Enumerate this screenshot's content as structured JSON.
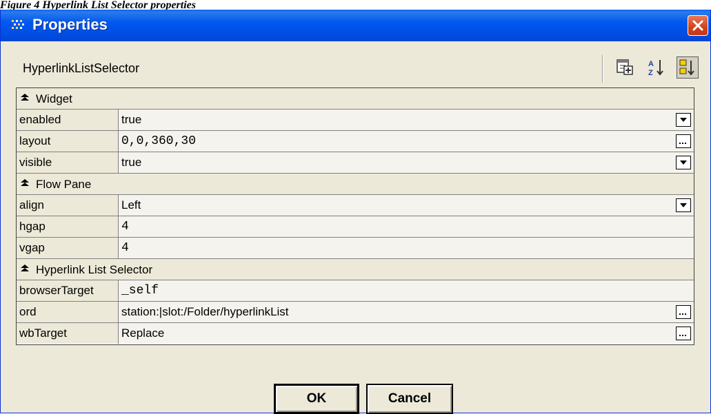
{
  "caption": "Figure 4 Hyperlink List Selector properties",
  "window": {
    "title": "Properties",
    "header": "HyperlinkListSelector",
    "icons": [
      "properties-app-icon",
      "add-slot-icon",
      "sort-alpha-icon",
      "sort-natural-icon",
      "close-icon"
    ]
  },
  "categories": [
    {
      "label": "Widget",
      "props": [
        {
          "name": "enabled",
          "value": "true",
          "control": "dropdown"
        },
        {
          "name": "layout",
          "value": "0,0,360,30",
          "control": "ellipsis"
        },
        {
          "name": "visible",
          "value": "true",
          "control": "dropdown"
        }
      ]
    },
    {
      "label": "Flow Pane",
      "props": [
        {
          "name": "align",
          "value": "Left",
          "control": "dropdown"
        },
        {
          "name": "hgap",
          "value": "4"
        },
        {
          "name": "vgap",
          "value": "4"
        }
      ]
    },
    {
      "label": "Hyperlink List Selector",
      "props": [
        {
          "name": "browserTarget",
          "value": "_self"
        },
        {
          "name": "ord",
          "value": "station:|slot:/Folder/hyperlinkList",
          "control": "ellipsis"
        },
        {
          "name": "wbTarget",
          "value": "Replace",
          "control": "ellipsis"
        }
      ]
    }
  ],
  "buttons": {
    "ok": "OK",
    "cancel": "Cancel"
  },
  "colors": {
    "titlebar": "#0058ee",
    "close": "#d0431c",
    "dialog_bg": "#ece9d8"
  }
}
